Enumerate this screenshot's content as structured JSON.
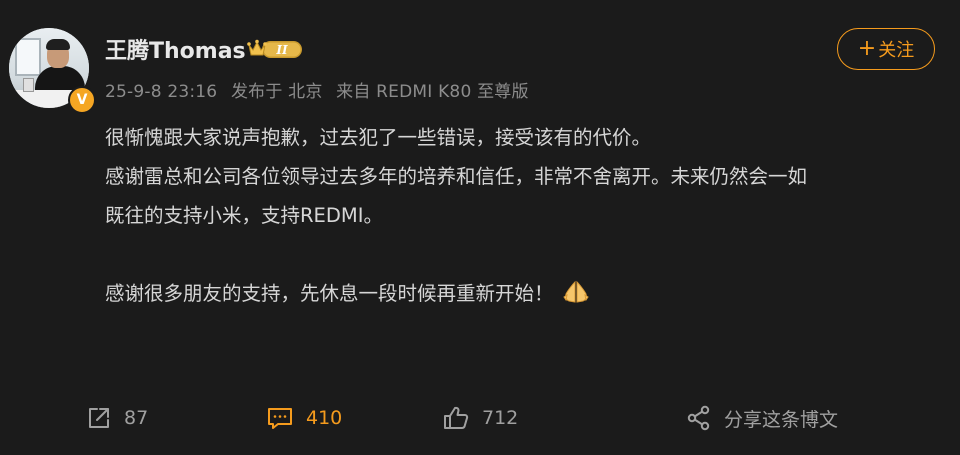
{
  "post": {
    "user": {
      "name": "王腾Thomas",
      "level_badge": "II",
      "verified_badge": "V",
      "avatar_icon": "user-avatar-photo"
    },
    "meta": {
      "date": "25-9-8 23:16",
      "published_at": "发布于 北京",
      "source": "来自 REDMI K80 至尊版"
    },
    "follow_button": {
      "plus": "+",
      "label": "关注"
    },
    "content": {
      "line1": "很惭愧跟大家说声抱歉，过去犯了一些错误，接受该有的代价。",
      "line2": "感谢雷总和公司各位领导过去多年的培养和信任，非常不舍离开。未来仍然会一如",
      "line3": "既往的支持小米，支持REDMI。",
      "line4": "感谢很多朋友的支持，先休息一段时候再重新开始！",
      "emoji_icon": "folded-hands-icon"
    },
    "actions": {
      "repost_count": "87",
      "comment_count": "410",
      "like_count": "712",
      "share_label": "分享这条博文"
    },
    "colors": {
      "accent": "#f59b1d",
      "background": "#1b1b1b",
      "text": "#d6d6d6",
      "meta_text": "#8c8c8c"
    }
  }
}
